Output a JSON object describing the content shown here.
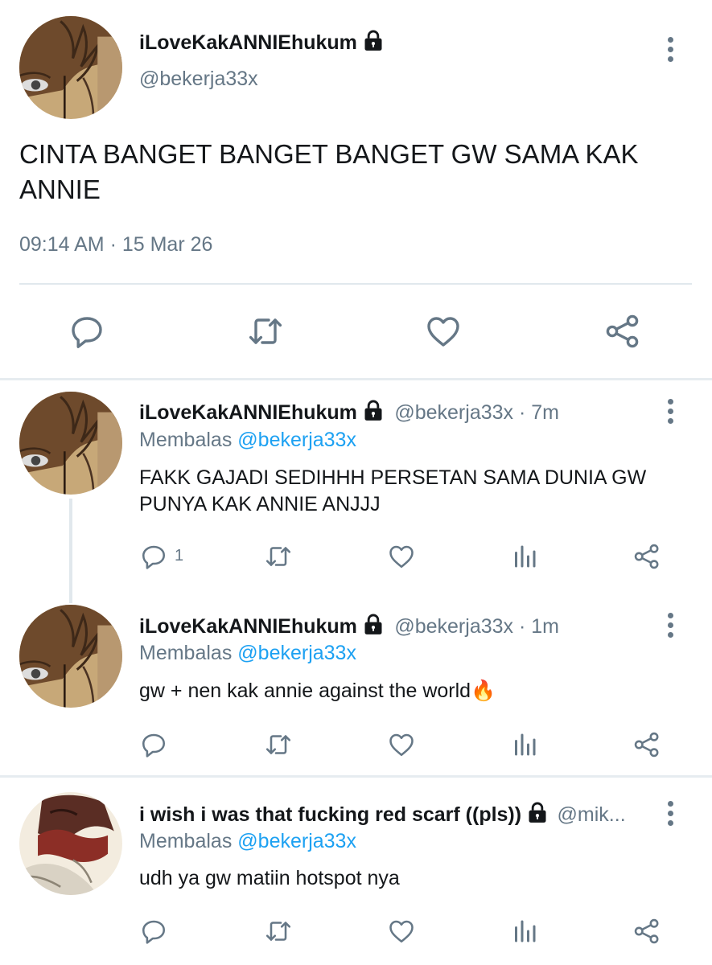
{
  "main_tweet": {
    "display_name": "iLoveKakANNIEhukum",
    "handle": "@bekerja33x",
    "text_line1": "CINTA BANGET BANGET BANGET GW SAMA KAK",
    "text_line2": "ANNIE",
    "timestamp": "09:14 AM · 15 Mar 26",
    "avatar_icon": "character-avatar",
    "lock_icon": "lock-icon"
  },
  "replies": [
    {
      "display_name": "iLoveKakANNIEhukum",
      "handle_time": "@bekerja33x · 7m",
      "reply_prefix": "Membalas",
      "reply_to": "@bekerja33x",
      "text_line1": "FAKK GAJADI SEDIHHH PERSETAN SAMA DUNIA GW",
      "text_line2": "PUNYA KAK ANNIE ANJJJ",
      "reply_count": "1"
    },
    {
      "display_name": "iLoveKakANNIEhukum",
      "handle_time": "@bekerja33x · 1m",
      "reply_prefix": "Membalas",
      "reply_to": "@bekerja33x",
      "text": "gw + nen kak annie against the world",
      "emoji": "🔥"
    },
    {
      "display_name": "i wish i was that fucking red scarf ((pls))",
      "handle_time": "@mik...",
      "reply_prefix": "Membalas",
      "reply_to": "@bekerja33x",
      "text": "udh ya gw matiin hotspot nya"
    }
  ],
  "colors": {
    "text": "#14171a",
    "secondary": "#657786",
    "link": "#1da1f2",
    "divider": "#e6ecf0"
  }
}
